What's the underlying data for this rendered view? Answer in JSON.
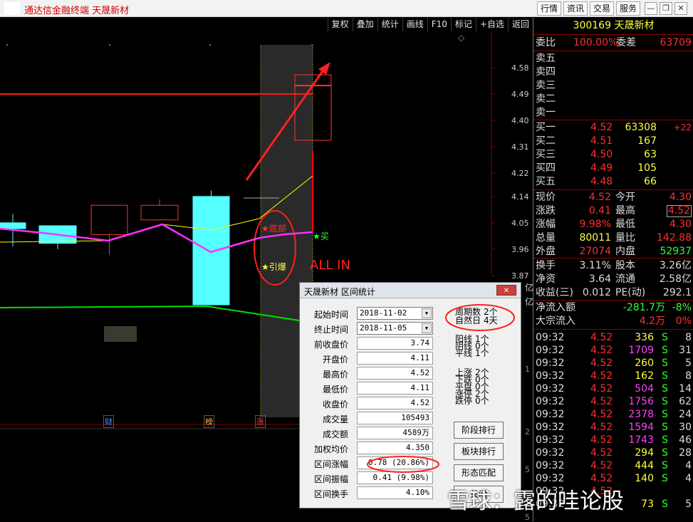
{
  "window": {
    "title": "通达信金融终端 天晟新材",
    "buttons": [
      "行情",
      "资讯",
      "交易",
      "服务"
    ],
    "controls": [
      "minimize",
      "restore",
      "close"
    ]
  },
  "toolbar": {
    "buttons": [
      "复权",
      "叠加",
      "统计",
      "画线",
      "F10",
      "标记",
      "+自选",
      "返回"
    ]
  },
  "chart": {
    "price_ticks": [
      "4.58",
      "4.49",
      "4.40",
      "4.31",
      "4.22",
      "4.14",
      "4.05",
      "3.96",
      "3.87"
    ],
    "right_marks": [
      "亿",
      "亿",
      "1",
      "2",
      "5",
      "5"
    ],
    "markers": {
      "cai": "财",
      "bang": "榜",
      "zhang": "涨"
    },
    "annotations": {
      "bottom": "★底部",
      "detonate": "★引爆",
      "buy": "★买",
      "all_in": "ALL IN"
    },
    "colors": {
      "up": "#ff3232",
      "down": "#54ffff",
      "ma_fast": "#ffff00",
      "ma_mid": "#ff30ff",
      "ma_slow": "#00e000",
      "highlight": "#ff0000"
    },
    "candles": [
      {
        "date": "",
        "open": 4.05,
        "close": 4.03,
        "high": 4.08,
        "low": 3.97
      },
      {
        "date": "",
        "open": 4.04,
        "close": 3.98,
        "high": 4.04,
        "low": 3.96
      },
      {
        "date": "",
        "open": 4.01,
        "close": 4.11,
        "high": 4.11,
        "low": 3.94
      },
      {
        "date": "",
        "open": 4.06,
        "close": 4.11,
        "high": 4.13,
        "low": 4.06
      },
      {
        "date": "",
        "open": 4.14,
        "close": 3.77,
        "high": 4.16,
        "low": 3.77
      },
      {
        "date": "",
        "open": 4.14,
        "close": 4.14,
        "high": 4.14,
        "low": 4.14
      },
      {
        "date": "2018-11-05",
        "open": 4.52,
        "close": 4.52,
        "high": 4.52,
        "low": 4.52
      }
    ]
  },
  "quote": {
    "code": "300169",
    "name": "天晟新材",
    "weibi_label": "委比",
    "weibi": "100.00%",
    "weicha_label": "委差",
    "weicha": "63709",
    "sell": [
      {
        "label": "卖五"
      },
      {
        "label": "卖四"
      },
      {
        "label": "卖三"
      },
      {
        "label": "卖二"
      },
      {
        "label": "卖一"
      }
    ],
    "buy": [
      {
        "label": "买一",
        "price": "4.52",
        "vol": "63308",
        "chg": "+22"
      },
      {
        "label": "买二",
        "price": "4.51",
        "vol": "167",
        "chg": ""
      },
      {
        "label": "买三",
        "price": "4.50",
        "vol": "63",
        "chg": ""
      },
      {
        "label": "买四",
        "price": "4.49",
        "vol": "105",
        "chg": ""
      },
      {
        "label": "买五",
        "price": "4.48",
        "vol": "66",
        "chg": ""
      }
    ],
    "stats": [
      {
        "l1": "现价",
        "v1": "4.52",
        "l2": "今开",
        "v2": "4.30"
      },
      {
        "l1": "涨跌",
        "v1": "0.41",
        "l2": "最高",
        "v2": "4.52"
      },
      {
        "l1": "涨幅",
        "v1": "9.98%",
        "l2": "最低",
        "v2": "4.30"
      },
      {
        "l1": "总量",
        "v1": "80011",
        "l2": "量比",
        "v2": "142.88"
      },
      {
        "l1": "外盘",
        "v1": "27074",
        "l2": "内盘",
        "v2": "52937"
      }
    ],
    "stats2": [
      {
        "l1": "换手",
        "v1": "3.11%",
        "l2": "股本",
        "v2": "3.26亿"
      },
      {
        "l1": "净资",
        "v1": "3.64",
        "l2": "流通",
        "v2": "2.58亿"
      },
      {
        "l1": "收益(三)",
        "v1": "0.012",
        "l2": "PE(动)",
        "v2": "292.1"
      }
    ],
    "flow": [
      {
        "label": "净流入额",
        "v1": "-281.7万",
        "v2": "-8%"
      },
      {
        "label": "大宗流入",
        "v1": "4.2万",
        "v2": "0%"
      }
    ],
    "ticks": [
      {
        "t": "09:32",
        "p": "4.52",
        "v": "336",
        "s": "S",
        "n": "8"
      },
      {
        "t": "09:32",
        "p": "4.52",
        "v": "1709",
        "s": "S",
        "n": "31"
      },
      {
        "t": "09:32",
        "p": "4.52",
        "v": "260",
        "s": "S",
        "n": "5"
      },
      {
        "t": "09:32",
        "p": "4.52",
        "v": "162",
        "s": "S",
        "n": "8"
      },
      {
        "t": "09:32",
        "p": "4.52",
        "v": "504",
        "s": "S",
        "n": "14"
      },
      {
        "t": "09:32",
        "p": "4.52",
        "v": "1756",
        "s": "S",
        "n": "62"
      },
      {
        "t": "09:32",
        "p": "4.52",
        "v": "2378",
        "s": "S",
        "n": "24"
      },
      {
        "t": "09:32",
        "p": "4.52",
        "v": "1594",
        "s": "S",
        "n": "30"
      },
      {
        "t": "09:32",
        "p": "4.52",
        "v": "1743",
        "s": "S",
        "n": "46"
      },
      {
        "t": "09:32",
        "p": "4.52",
        "v": "294",
        "s": "S",
        "n": "28"
      },
      {
        "t": "09:32",
        "p": "4.52",
        "v": "444",
        "s": "S",
        "n": "4"
      },
      {
        "t": "09:32",
        "p": "4.52",
        "v": "140",
        "s": "S",
        "n": "4"
      },
      {
        "t": "09:32",
        "p": "4.52",
        "v": "",
        "s": "",
        "n": ""
      },
      {
        "t": "09:32",
        "p": "",
        "v": "73",
        "s": "S",
        "n": "5"
      }
    ]
  },
  "dialog": {
    "title": "天晟新材 区间统计",
    "close": "✕",
    "fields": [
      {
        "label": "起始时间",
        "value": "2018-11-02",
        "type": "date"
      },
      {
        "label": "终止时间",
        "value": "2018-11-05",
        "type": "date"
      },
      {
        "label": "前收盘价",
        "value": "3.74"
      },
      {
        "label": "开盘价",
        "value": "4.11"
      },
      {
        "label": "最高价",
        "value": "4.52"
      },
      {
        "label": "最低价",
        "value": "4.11"
      },
      {
        "label": "收盘价",
        "value": "4.52"
      },
      {
        "label": "成交量",
        "value": "105493"
      },
      {
        "label": "成交额",
        "value": "4589万"
      },
      {
        "label": "加权均价",
        "value": "4.350"
      },
      {
        "label": "区间涨幅",
        "value": "0.78 (20.86%)"
      },
      {
        "label": "区间振幅",
        "value": "0.41 (9.98%)"
      },
      {
        "label": "区间换手",
        "value": "4.10%"
      }
    ],
    "period": [
      {
        "label": "周期数",
        "value": "2个"
      },
      {
        "label": "自然日",
        "value": "4天"
      }
    ],
    "lines": [
      {
        "label": "阳线",
        "value": "1个"
      },
      {
        "label": "阴线",
        "value": "0个"
      },
      {
        "label": "平线",
        "value": "1个"
      }
    ],
    "moves": [
      {
        "label": "上涨",
        "value": "2个"
      },
      {
        "label": "下跌",
        "value": "0个"
      },
      {
        "label": "平盘",
        "value": "0个"
      },
      {
        "label": "涨停",
        "value": "2个"
      },
      {
        "label": "跌停",
        "value": "0个"
      }
    ],
    "buttons": [
      "阶段排行",
      "板块排行",
      "形态匹配",
      "关闭"
    ]
  },
  "watermark": "雪球：露的哇论股"
}
